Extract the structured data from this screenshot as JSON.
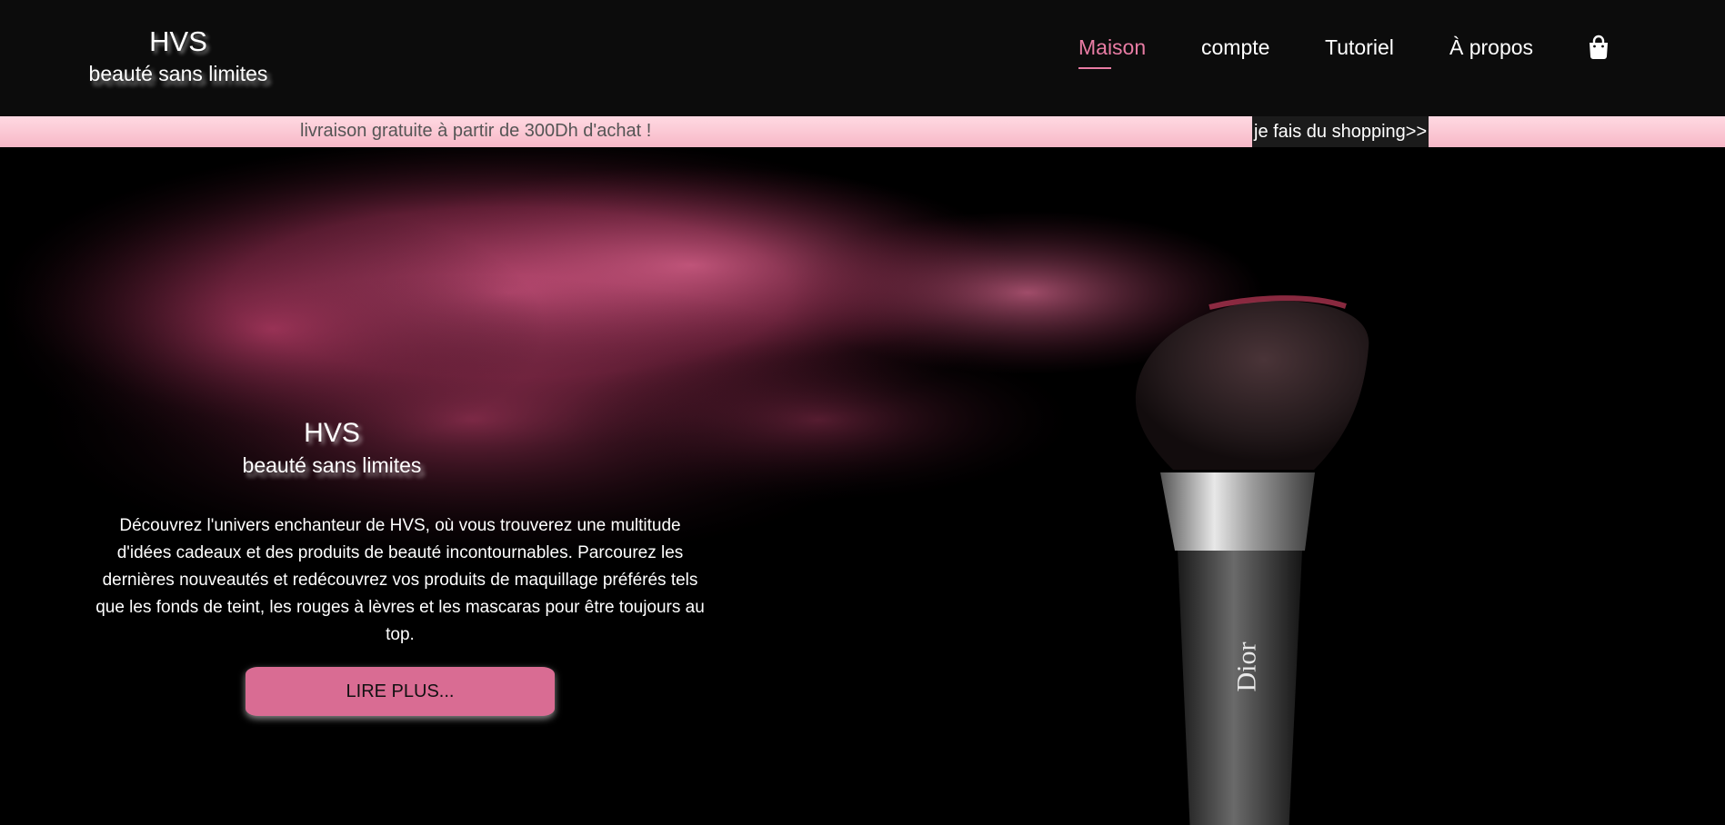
{
  "header": {
    "brand_name": "HVS",
    "brand_tagline": "beauté sans limites",
    "nav": [
      {
        "label": "Maison",
        "active": true
      },
      {
        "label": "compte",
        "active": false
      },
      {
        "label": "Tutoriel",
        "active": false
      },
      {
        "label": "À propos",
        "active": false
      }
    ],
    "cart_icon": "shopping-bag-icon"
  },
  "promo": {
    "text": "livraison gratuite à partir de 300Dh d'achat !",
    "shop_button": "je fais du shopping>>"
  },
  "hero": {
    "brand_name": "HVS",
    "brand_tagline": "beauté sans limites",
    "description": "Découvrez l'univers enchanteur de HVS, où vous trouverez une multitude d'idées cadeaux et des produits de beauté incontournables. Parcourez les dernières nouveautés et redécouvrez vos produits de maquillage préférés tels que les fonds de teint, les rouges à lèvres et les mascaras pour être toujours au top.",
    "read_more_label": "LIRE PLUS...",
    "brush_brand": "Dior"
  },
  "colors": {
    "accent": "#e87ca4",
    "button": "#d96c93",
    "promo_bg": "#fcc6d2",
    "header_bg": "#0c0c0c"
  }
}
